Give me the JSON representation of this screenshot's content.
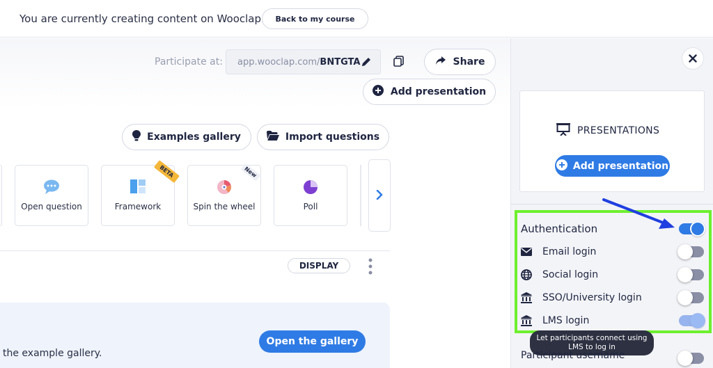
{
  "banner": {
    "text": "You are currently creating content on Wooclap.",
    "back_button": "Back to my course"
  },
  "header": {
    "participate_label": "Participate at:",
    "url_prefix": "app.wooclap.com/",
    "url_code": "BNTGTA",
    "share_label": "Share",
    "add_presentation_label": "Add presentation"
  },
  "toolbar": {
    "examples_label": "Examples gallery",
    "import_label": "Import questions"
  },
  "question_types": [
    {
      "label": "Open question",
      "icon": "speech-bubble-icon"
    },
    {
      "label": "Framework",
      "icon": "framework-icon",
      "badge": "BETA"
    },
    {
      "label": "Spin the wheel",
      "icon": "wheel-icon",
      "badge": "New"
    },
    {
      "label": "Poll",
      "icon": "pie-chart-icon"
    }
  ],
  "display_label": "DISPLAY",
  "gallery": {
    "text": "the example gallery.",
    "button": "Open the gallery"
  },
  "side": {
    "presentations_title": "PRESENTATIONS",
    "add_presentation_label": "Add presentation",
    "authentication_label": "Authentication",
    "options": [
      {
        "label": "Email login",
        "icon": "envelope-icon",
        "enabled": false
      },
      {
        "label": "Social login",
        "icon": "globe-icon",
        "enabled": false
      },
      {
        "label": "SSO/University login",
        "icon": "university-icon",
        "enabled": false
      },
      {
        "label": "LMS login",
        "icon": "university-icon",
        "enabled": true
      }
    ],
    "tooltip": "Let participants connect using LMS to log in",
    "participant_username_label": "Participant username"
  },
  "colors": {
    "accent": "#2f7be5",
    "highlight_border": "#6ef02f",
    "annotation_arrow": "#1f3fe0",
    "beta_badge": "#f3b73a"
  }
}
